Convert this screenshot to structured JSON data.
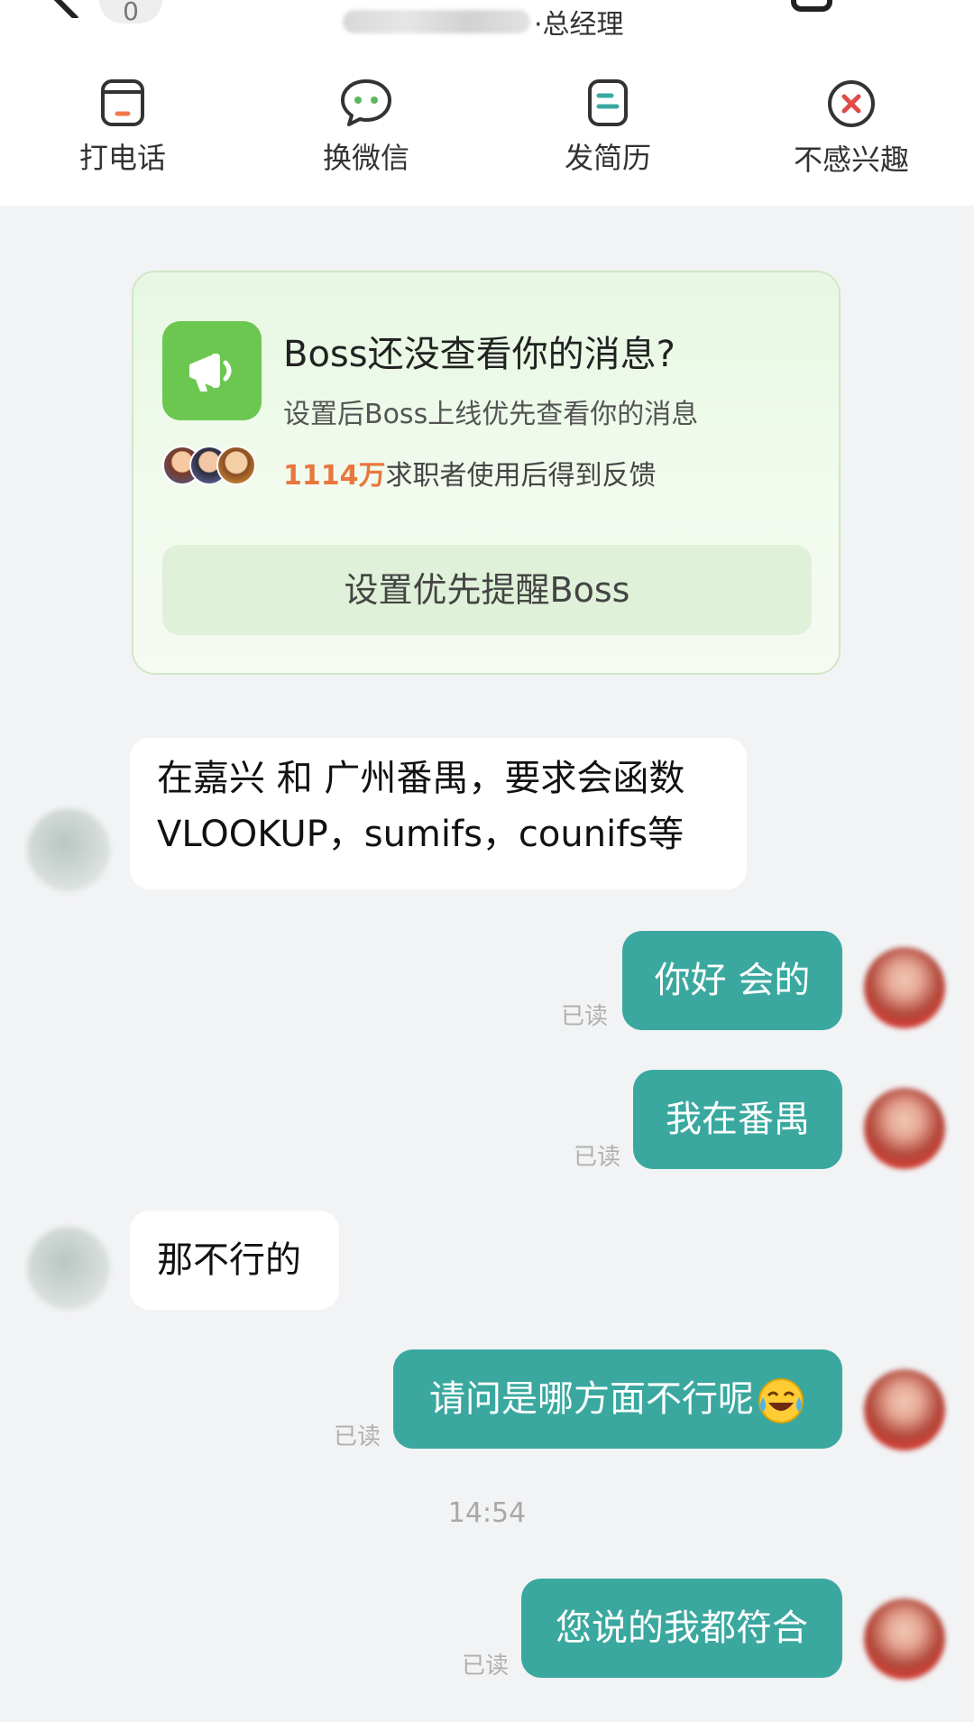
{
  "header": {
    "badge": "0",
    "title_suffix": "·总经理",
    "actions": [
      {
        "label": "打电话",
        "icon": "phone-card-icon"
      },
      {
        "label": "换微信",
        "icon": "wechat-icon"
      },
      {
        "label": "发简历",
        "icon": "resume-icon"
      },
      {
        "label": "不感兴趣",
        "icon": "not-interested-icon"
      }
    ]
  },
  "promo": {
    "title": "Boss还没查看你的消息?",
    "subtitle": "设置后Boss上线优先查看你的消息",
    "count": "1114万",
    "count_suffix": "求职者使用后得到反馈",
    "button": "设置优先提醒Boss",
    "icon": "megaphone-icon"
  },
  "messages": [
    {
      "from": "boss",
      "lines": [
        "在嘉兴 和 广州番禺，要求会函数",
        "VLOOKUP，sumifs，counifs等"
      ]
    },
    {
      "from": "me",
      "text": "你好 会的",
      "status": "已读"
    },
    {
      "from": "me",
      "text": "我在番禺",
      "status": "已读"
    },
    {
      "from": "boss",
      "text": "那不行的"
    },
    {
      "from": "me",
      "text": "请问是哪方面不行呢",
      "status": "已读",
      "emoji": "crying-laughing-emoji"
    },
    {
      "time": "14:54"
    },
    {
      "from": "me",
      "text": "您说的我都符合",
      "status": "已读"
    }
  ],
  "colors": {
    "accent_teal": "#3aa89f",
    "promo_green": "#6cc751",
    "count_orange": "#e8773e",
    "background": "#f2f3f5"
  }
}
